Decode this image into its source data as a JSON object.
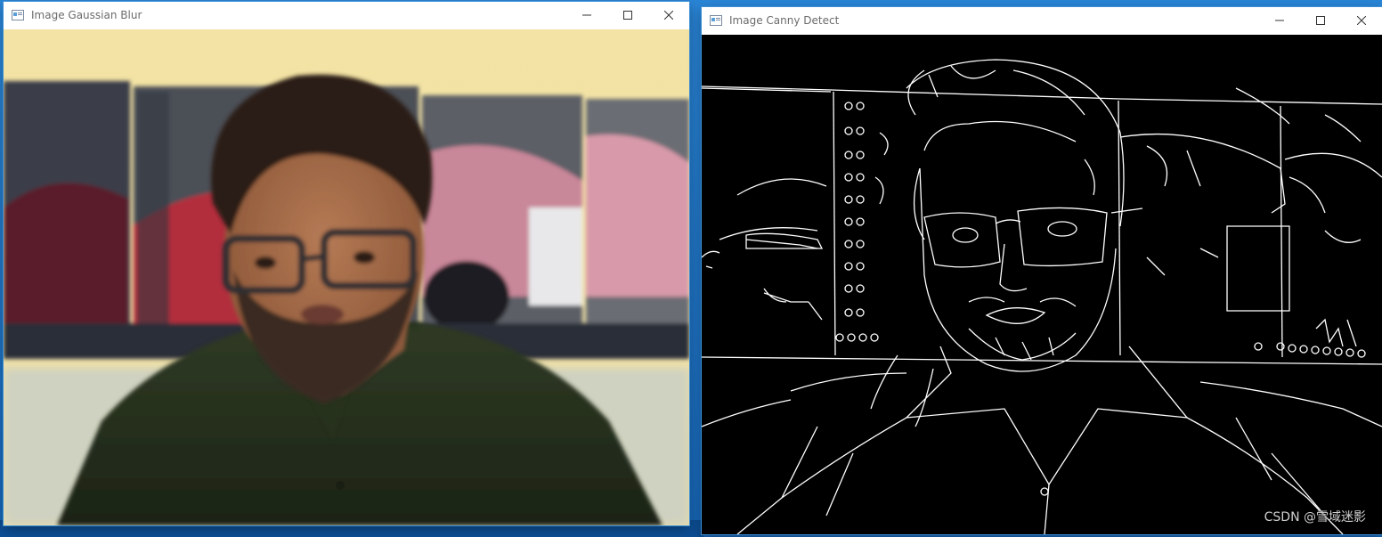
{
  "windows": [
    {
      "title": "Image Gaussian Blur",
      "icon": "image-window-icon",
      "controls": [
        "minimize-icon",
        "maximize-icon",
        "close-icon"
      ]
    },
    {
      "title": "Image Canny Detect",
      "icon": "image-window-icon",
      "controls": [
        "minimize-icon",
        "maximize-icon",
        "close-icon"
      ]
    }
  ],
  "watermark": "CSDN @雪域迷影",
  "colors": {
    "desktop": "#1a76c9",
    "titlebar": "#ffffff",
    "edges_bg": "#000000",
    "edges_line": "#ffffff"
  }
}
